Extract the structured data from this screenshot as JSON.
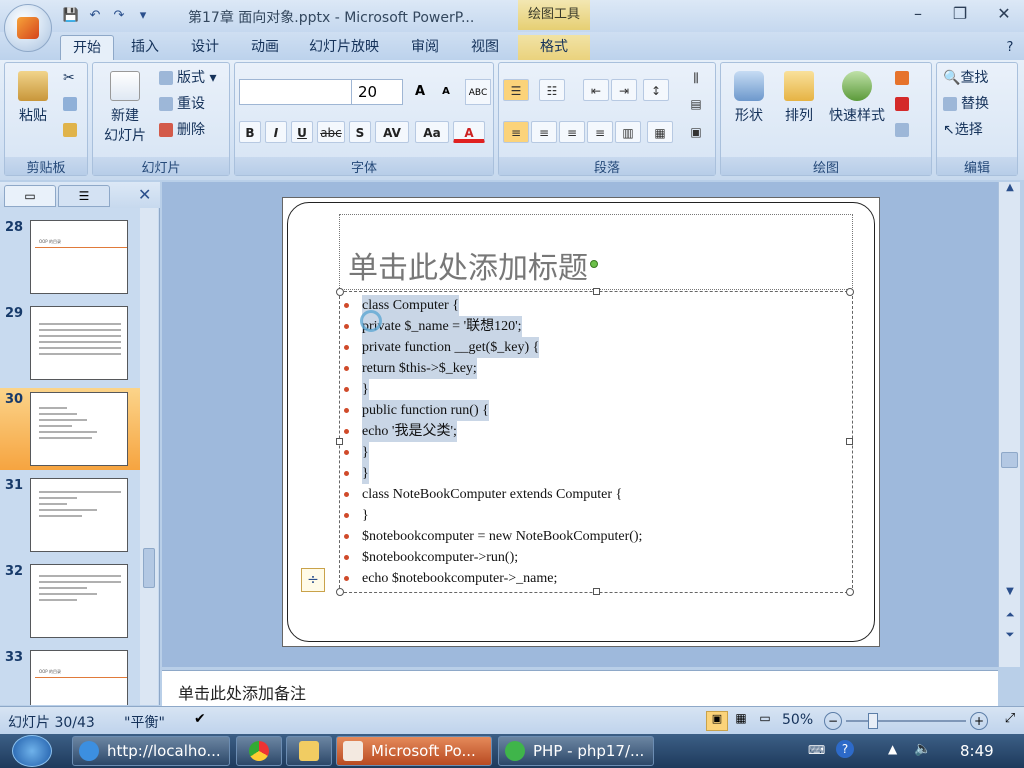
{
  "window": {
    "title": "第17章 面向对象.pptx - Microsoft PowerP...",
    "context_tab_title": "绘图工具",
    "minimize": "–",
    "restore": "❐",
    "close": "✕"
  },
  "qat": {
    "save": "💾",
    "undo": "↶",
    "redo": "↷"
  },
  "tabs": [
    "开始",
    "插入",
    "设计",
    "动画",
    "幻灯片放映",
    "审阅",
    "视图",
    "格式"
  ],
  "ribbon": {
    "clipboard": {
      "label": "剪贴板",
      "paste": "粘贴"
    },
    "slides": {
      "label": "幻灯片",
      "new_slide": "新建",
      "new_slide2": "幻灯片",
      "layout": "版式",
      "reset": "重设",
      "delete": "删除"
    },
    "font": {
      "label": "字体",
      "font_name": "",
      "font_size": "20",
      "grow": "A",
      "shrink": "A",
      "bold": "B",
      "italic": "I",
      "underline": "U",
      "strike": "abc",
      "shadow": "S",
      "spacing": "AV",
      "case": "Aa",
      "color": "A"
    },
    "paragraph": {
      "label": "段落"
    },
    "drawing": {
      "label": "绘图",
      "shapes": "形状",
      "arrange": "排列",
      "quick_styles": "快速样式"
    },
    "editing": {
      "label": "编辑",
      "find": "查找",
      "replace": "替换",
      "select": "选择"
    }
  },
  "left_pane": {
    "slides": [
      {
        "num": "28",
        "title": "OOP 的目录",
        "selected": false
      },
      {
        "num": "29",
        "title": "",
        "selected": false
      },
      {
        "num": "30",
        "title": "",
        "selected": true
      },
      {
        "num": "31",
        "title": "",
        "selected": false
      },
      {
        "num": "32",
        "title": "",
        "selected": false
      },
      {
        "num": "33",
        "title": "OOP 的目录",
        "selected": false
      }
    ]
  },
  "slide": {
    "title_placeholder": "单击此处添加标题",
    "lines": [
      {
        "text": "class Computer {",
        "hl": true
      },
      {
        "text": "private $_name = '联想120';",
        "hl": true
      },
      {
        "text": "private function __get($_key) {",
        "hl": true
      },
      {
        "text": "return $this->$_key;",
        "hl": true
      },
      {
        "text": "}",
        "hl": true
      },
      {
        "text": "public function run() {",
        "hl": true
      },
      {
        "text": "echo '我是父类';",
        "hl": true
      },
      {
        "text": "}",
        "hl": true
      },
      {
        "text": "}",
        "hl": true
      },
      {
        "text": "class NoteBookComputer extends Computer {",
        "hl": false
      },
      {
        "text": "}",
        "hl": false
      },
      {
        "text": "$notebookcomputer = new NoteBookComputer();",
        "hl": false
      },
      {
        "text": "$notebookcomputer->run();",
        "hl": false
      },
      {
        "text": "echo $notebookcomputer->_name;",
        "hl": false
      }
    ]
  },
  "notes_placeholder": "单击此处添加备注",
  "status": {
    "slide_info": "幻灯片 30/43",
    "theme": "\"平衡\"",
    "zoom": "50%"
  },
  "taskbar": {
    "items": [
      "http://localho...",
      "",
      "",
      "Microsoft Po...",
      "PHP - php17/..."
    ],
    "time": "8:49"
  },
  "colors": {
    "accent": "#f6a440",
    "ribbon": "#d3e2f4",
    "taskbar": "#1e3a5c"
  }
}
